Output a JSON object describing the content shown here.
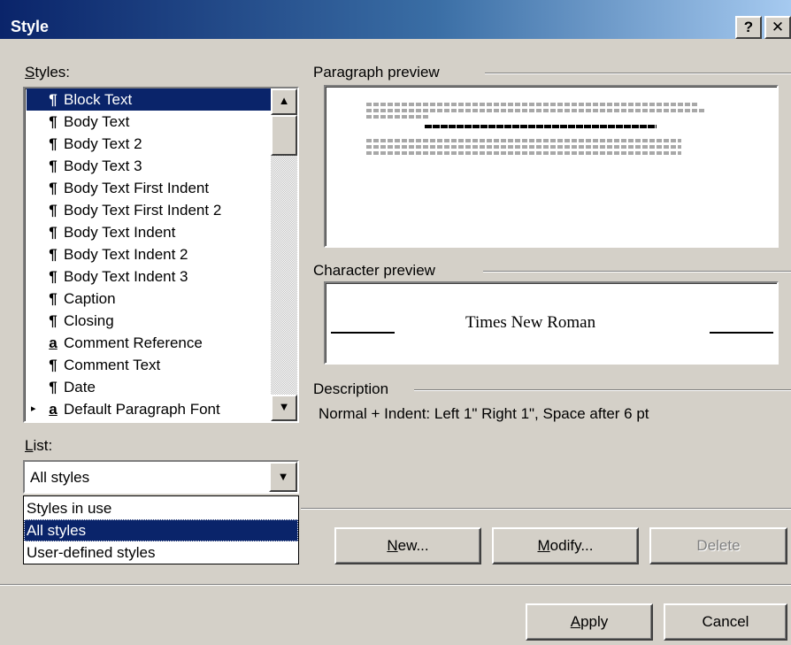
{
  "dialog": {
    "title": "Style",
    "help_button": "?",
    "close_button": "✕"
  },
  "styles_label": {
    "accel": "S",
    "rest": "tyles:"
  },
  "styles": [
    {
      "mark": "¶",
      "name": "Block Text",
      "selected": true
    },
    {
      "mark": "¶",
      "name": "Body Text"
    },
    {
      "mark": "¶",
      "name": "Body Text 2"
    },
    {
      "mark": "¶",
      "name": "Body Text 3"
    },
    {
      "mark": "¶",
      "name": "Body Text First Indent"
    },
    {
      "mark": "¶",
      "name": "Body Text First Indent 2"
    },
    {
      "mark": "¶",
      "name": "Body Text Indent"
    },
    {
      "mark": "¶",
      "name": "Body Text Indent 2"
    },
    {
      "mark": "¶",
      "name": "Body Text Indent 3"
    },
    {
      "mark": "¶",
      "name": "Caption"
    },
    {
      "mark": "¶",
      "name": "Closing"
    },
    {
      "mark": "a",
      "name": "Comment Reference"
    },
    {
      "mark": "¶",
      "name": "Comment Text"
    },
    {
      "mark": "¶",
      "name": "Date"
    },
    {
      "mark": "a",
      "name": "Default Paragraph Font",
      "pointer": "▸"
    }
  ],
  "list_label": {
    "accel": "L",
    "rest": "ist:"
  },
  "list_combo": {
    "value": "All styles",
    "options": [
      "Styles in use",
      "All styles",
      "User-defined styles"
    ],
    "selected_index": 1
  },
  "paragraph_preview": {
    "label": "Paragraph preview",
    "sample_url": "http://www.antsbizzrisingiveniaslines.com/e_c1.908_c8_88.html"
  },
  "character_preview": {
    "label": "Character preview",
    "sample": "Times New Roman"
  },
  "description": {
    "label": "Description",
    "text": "Normal + Indent:  Left  1\" Right  1\", Space  after 6 pt"
  },
  "buttons": {
    "new": {
      "accel": "N",
      "rest": "ew..."
    },
    "modify": {
      "accel": "M",
      "rest": "odify..."
    },
    "delete": "Delete",
    "apply": {
      "accel": "A",
      "rest": "pply"
    },
    "cancel": "Cancel"
  },
  "icons": {
    "paragraph_mark": "¶",
    "scroll_up": "▲",
    "scroll_down": "▼",
    "combo_arrow": "▼"
  }
}
